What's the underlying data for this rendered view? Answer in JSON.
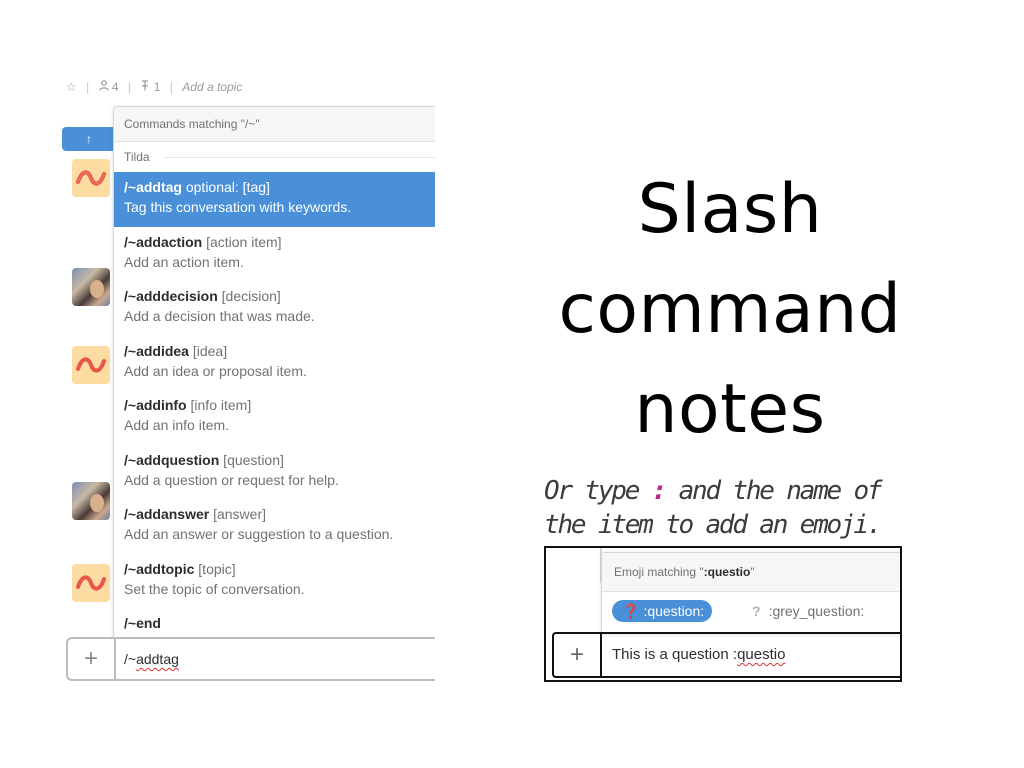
{
  "slide": {
    "title_line1": "Slash command",
    "title_line2": "notes",
    "note_part1": "Or type ",
    "note_colon": ":",
    "note_part2": " and the name of",
    "note_line2": "the item to add an emoji."
  },
  "channel_header": {
    "star_icon": "☆",
    "members_icon": "person-icon",
    "members_count": "4",
    "pins_icon": "pin-icon",
    "pins_count": "1",
    "topic_placeholder": "Add a topic"
  },
  "jump_button": {
    "label": "↑"
  },
  "autocomplete": {
    "header": "Commands matching \"/~\"",
    "group_label": "Tilda",
    "commands": [
      {
        "name": "/~addtag",
        "args": " optional: [tag]",
        "desc": "Tag this conversation with keywords."
      },
      {
        "name": "/~addaction",
        "args": " [action item]",
        "desc": "Add an action item."
      },
      {
        "name": "/~adddecision",
        "args": " [decision]",
        "desc": "Add a decision that was made."
      },
      {
        "name": "/~addidea",
        "args": " [idea]",
        "desc": "Add an idea or proposal item."
      },
      {
        "name": "/~addinfo",
        "args": " [info item]",
        "desc": "Add an info item."
      },
      {
        "name": "/~addquestion",
        "args": " [question]",
        "desc": "Add a question or request for help."
      },
      {
        "name": "/~addanswer",
        "args": " [answer]",
        "desc": "Add an answer or suggestion to a question."
      },
      {
        "name": "/~addtopic",
        "args": " [topic]",
        "desc": "Set the topic of conversation."
      },
      {
        "name": "/~end"
      }
    ]
  },
  "composer": {
    "plus_label": "+",
    "input_prefix": "/~",
    "input_word": "addtag"
  },
  "emoji_popup": {
    "header_prefix": "Emoji matching \"",
    "header_query": ":questio",
    "header_suffix": "\"",
    "options": [
      {
        "glyph": "❓",
        "label": ":question:"
      },
      {
        "glyph": "?",
        "label": ":grey_question:"
      }
    ]
  },
  "emoji_composer": {
    "plus_label": "+",
    "text_prefix": "This is a question :",
    "text_word": "questio"
  },
  "colors": {
    "selection_blue": "#4a90d9",
    "colon_accent": "#b9278f",
    "red_question": "#d0021b"
  }
}
